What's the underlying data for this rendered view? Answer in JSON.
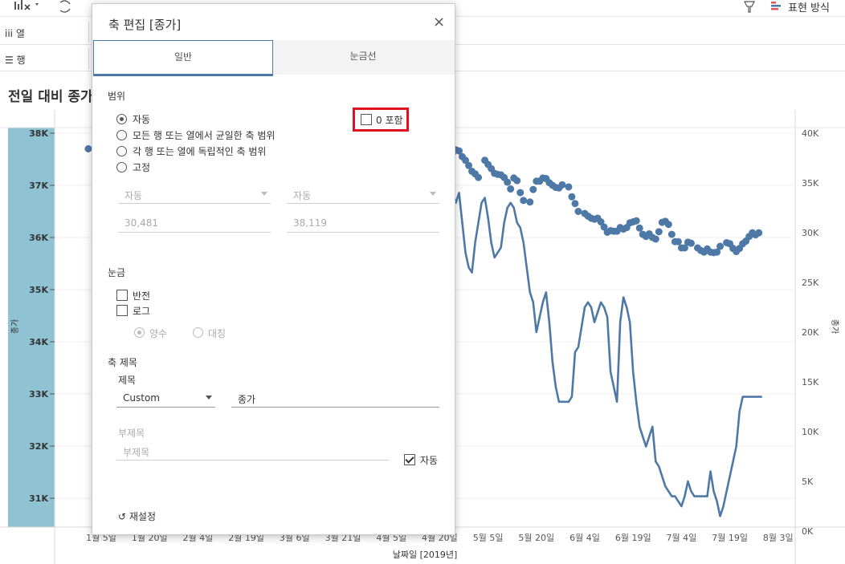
{
  "toolbar": {
    "format_label": "표현 방식"
  },
  "shelves": {
    "columns_label": "열",
    "rows_label": "행"
  },
  "sheet": {
    "title": "전일 대비 종가"
  },
  "chart_data": {
    "type": "line",
    "x_label": "날짜일 [2019년]",
    "x_ticks": [
      "1월 5일",
      "1월 20일",
      "2월 4일",
      "2월 19일",
      "3월 6일",
      "3월 21일",
      "4월 5일",
      "4월 20일",
      "5월 5일",
      "5월 20일",
      "6월 4일",
      "6월 19일",
      "7월 4일",
      "7월 19일",
      "8월 3일"
    ],
    "left_axis": {
      "label": "종가",
      "ticks": [
        "38K",
        "37K",
        "36K",
        "35K",
        "34K",
        "33K",
        "32K",
        "31K"
      ],
      "range": [
        30500,
        38100
      ]
    },
    "right_axis": {
      "label": "종가",
      "ticks": [
        "40K",
        "35K",
        "30K",
        "25K",
        "20K",
        "15K",
        "10K",
        "5K",
        "0K"
      ],
      "range": [
        0,
        40000
      ]
    },
    "series": [
      {
        "kind": "dots",
        "axis": "left",
        "color": "#4e79a7",
        "x": [
          1,
          108,
          109,
          110,
          111,
          112,
          113,
          114,
          115,
          116,
          117,
          118,
          119,
          120,
          121,
          122,
          124,
          125,
          126,
          127,
          128,
          129,
          130,
          131,
          132,
          133,
          134,
          135,
          136,
          138,
          139,
          140,
          141,
          142,
          143,
          144,
          145,
          146,
          147,
          148,
          150,
          151,
          152,
          153,
          155,
          156,
          157,
          158,
          159,
          160,
          161,
          162,
          163,
          164,
          165,
          166,
          167,
          168,
          169,
          170,
          171,
          172,
          173,
          174,
          175,
          176,
          177,
          178,
          179,
          180,
          181,
          182,
          183,
          184,
          185,
          186,
          187,
          188,
          190,
          191,
          192,
          193,
          194,
          195,
          196,
          197,
          199,
          200,
          201,
          202,
          203,
          204,
          205,
          206,
          207,
          208,
          209
        ],
        "y": [
          37.7,
          37.53,
          37.35,
          37.1,
          37.27,
          37.41,
          37.56,
          37.62,
          37.68,
          37.66,
          37.55,
          37.48,
          37.38,
          37.27,
          37.22,
          37.15,
          37.48,
          37.4,
          37.32,
          37.23,
          37.21,
          37.2,
          37.15,
          37.06,
          36.93,
          37.14,
          37.09,
          36.86,
          36.71,
          36.68,
          36.92,
          37.08,
          37.08,
          37.14,
          37.13,
          37.05,
          37.0,
          36.96,
          36.95,
          37.01,
          36.97,
          36.78,
          36.65,
          36.5,
          36.46,
          36.41,
          36.37,
          36.35,
          36.37,
          36.3,
          36.2,
          36.1,
          36.13,
          36.12,
          36.12,
          36.19,
          36.16,
          36.19,
          36.28,
          36.3,
          36.32,
          36.18,
          36.06,
          36.02,
          36.07,
          36.0,
          35.97,
          36.11,
          36.29,
          36.31,
          36.25,
          36.06,
          35.92,
          35.92,
          35.8,
          35.8,
          35.91,
          35.89,
          35.8,
          35.75,
          35.72,
          35.78,
          35.72,
          35.71,
          35.72,
          35.83,
          35.9,
          35.88,
          35.79,
          35.73,
          35.79,
          35.88,
          35.93,
          36.02,
          36.09,
          36.05,
          36.09
        ]
      },
      {
        "kind": "line",
        "axis": "right",
        "color": "#4e79a7",
        "x": [
          114,
          115,
          116,
          117,
          118,
          119,
          120,
          121,
          122,
          123,
          124,
          125,
          126,
          127,
          128,
          129,
          130,
          131,
          132,
          133,
          134,
          135,
          136,
          137,
          138,
          139,
          140,
          141,
          142,
          143,
          144,
          145,
          146,
          147,
          148,
          149,
          150,
          151,
          152,
          153,
          154,
          155,
          156,
          157,
          158,
          159,
          160,
          161,
          162,
          163,
          164,
          165,
          166,
          167,
          168,
          169,
          170,
          171,
          172,
          173,
          174,
          175,
          176,
          177,
          178,
          179,
          180,
          181,
          182,
          183,
          184,
          185,
          186,
          187,
          188,
          189,
          190,
          191,
          192,
          193,
          194,
          195,
          196,
          197,
          198,
          199,
          200,
          201,
          202,
          203,
          204,
          205,
          206,
          207,
          208,
          209,
          210
        ],
        "y": [
          34.0,
          33.0,
          34.0,
          31.0,
          28.0,
          26.5,
          26.0,
          29.0,
          31.0,
          33.0,
          33.5,
          31.5,
          29.0,
          27.5,
          28.0,
          28.5,
          31.0,
          32.5,
          33.0,
          32.5,
          31.0,
          30.5,
          29.0,
          26.5,
          24.0,
          23.0,
          20.0,
          21.5,
          23.0,
          24.0,
          21.0,
          17.0,
          14.5,
          13.0,
          13.0,
          13.0,
          13.0,
          13.5,
          18.0,
          18.5,
          20.5,
          22.5,
          23.0,
          22.5,
          21.0,
          22.0,
          23.0,
          22.5,
          21.5,
          16.0,
          14.5,
          13.0,
          21.0,
          23.5,
          22.5,
          21.0,
          16.0,
          13.0,
          10.5,
          9.5,
          8.5,
          9.5,
          10.5,
          7.0,
          6.5,
          5.5,
          4.5,
          4.0,
          3.5,
          3.5,
          3.0,
          2.5,
          3.5,
          5.0,
          4.0,
          3.5,
          3.5,
          3.5,
          3.5,
          3.5,
          6.0,
          4.0,
          3.0,
          1.5,
          2.5,
          4.0,
          5.5,
          7.0,
          8.5,
          12.0,
          13.5,
          13.5,
          13.5,
          13.5,
          13.5,
          13.5,
          13.5
        ]
      }
    ]
  },
  "dialog": {
    "title": "축 편집 [종가]",
    "close_icon": "×",
    "tabs": [
      "일반",
      "눈금선"
    ],
    "range": {
      "heading": "범위",
      "options": [
        "자동",
        "모든 행 또는 열에서 균일한 축 범위",
        "각 행 또는 열에 독립적인 축 범위",
        "고정"
      ],
      "selected": 0,
      "include_zero_label": "0 포함",
      "include_zero_checked": false,
      "start_mode": "자동",
      "end_mode": "자동",
      "start_value": "30,481",
      "end_value": "38,119"
    },
    "scale": {
      "heading": "눈금",
      "reversed_label": "반전",
      "log_label": "로그",
      "positive_label": "양수",
      "symmetric_label": "대칭"
    },
    "axis_title": {
      "heading": "축 제목",
      "title_label": "제목",
      "title_mode": "Custom",
      "title_value": "종가",
      "subtitle_label": "부제목",
      "subtitle_placeholder": "부제목",
      "auto_label": "자동",
      "auto_checked": true
    },
    "reset_label": "재설정"
  }
}
